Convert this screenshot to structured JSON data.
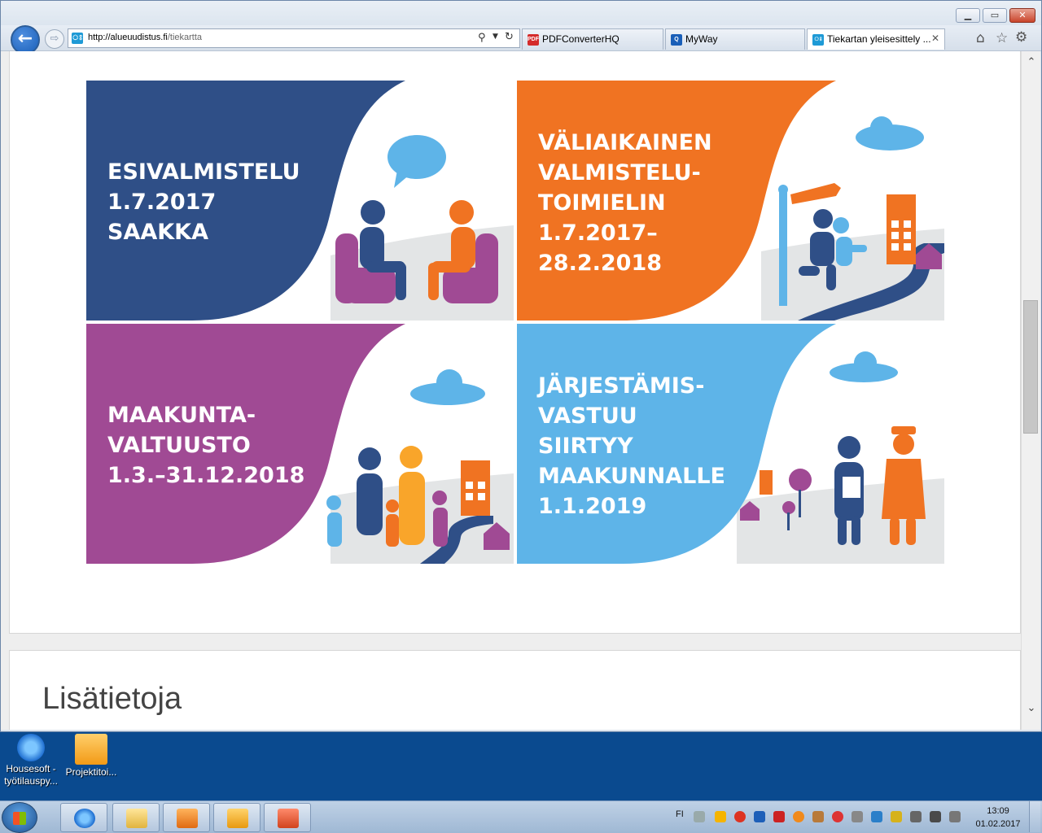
{
  "browser": {
    "url_host": "http://alueuudistus.fi",
    "url_path": "/tiekartta",
    "tabs": [
      {
        "label": "PDFConverterHQ",
        "icon": "pdf-icon"
      },
      {
        "label": "MyWay",
        "icon": "search-icon"
      },
      {
        "label": "Tiekartan yleisesittely ...",
        "icon": "site-icon",
        "active": true
      }
    ],
    "window_buttons": {
      "minimize": "▁",
      "maximize": "▭",
      "close": "✕"
    }
  },
  "panels": [
    {
      "lines": [
        "ESIVALMISTELU",
        "1.7.2017",
        "SAAKKA"
      ],
      "color": "#2f4f87"
    },
    {
      "lines": [
        "VÄLIAIKAINEN",
        "VALMISTELU-",
        "TOIMIELIN",
        "1.7.2017–",
        "28.2.2018"
      ],
      "color": "#f07322"
    },
    {
      "lines": [
        "MAAKUNTA-",
        "VALTUUSTO",
        "1.3.–31.12.2018"
      ],
      "color": "#a04a94"
    },
    {
      "lines": [
        "JÄRJESTÄMIS-",
        "VASTUU",
        "SIIRTYY",
        "MAAKUNNALLE",
        "1.1.2019"
      ],
      "color": "#5eb4e8"
    }
  ],
  "section_heading": "Lisätietoja",
  "desktop_icons": [
    {
      "line1": "Housesoft -",
      "line2": "työtilauspy..."
    },
    {
      "line1": "Projektitoi...",
      "line2": ""
    }
  ],
  "taskbar": {
    "language": "FI",
    "time": "13:09",
    "date": "01.02.2017"
  }
}
